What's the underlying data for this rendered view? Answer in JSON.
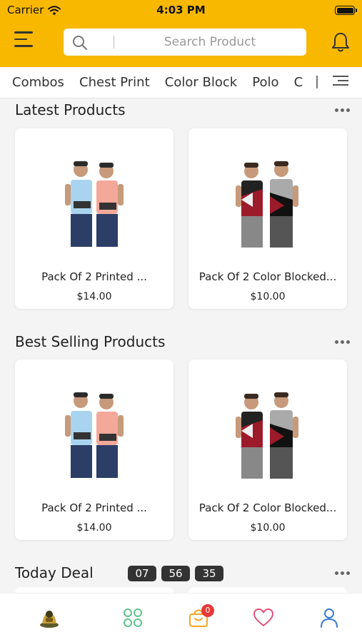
{
  "status_bar": {
    "carrier": "Carrier",
    "time": "4:03 PM"
  },
  "header": {
    "search_placeholder": "Search Product"
  },
  "categories": [
    "Combos",
    "Chest Print",
    "Color Block",
    "Polo",
    "C"
  ],
  "sections": [
    {
      "title": "Latest Products",
      "products": [
        {
          "name": "Pack Of 2 Printed ...",
          "price": "$14.00"
        },
        {
          "name": "Pack Of 2 Color Blocked...",
          "price": "$10.00"
        }
      ]
    },
    {
      "title": "Best Selling Products",
      "products": [
        {
          "name": "Pack Of 2 Printed ...",
          "price": "$14.00"
        },
        {
          "name": "Pack Of 2 Color Blocked...",
          "price": "$10.00"
        }
      ]
    }
  ],
  "today_deal": {
    "title": "Today Deal",
    "timer": [
      "07",
      "56",
      "35"
    ]
  },
  "tab_bar": {
    "cart_badge": "0"
  },
  "colors": {
    "brand": "#f8b800",
    "green": "#5cc38a",
    "orange": "#f5a623",
    "pink": "#e0507a",
    "blue": "#3a7bd5",
    "badge": "#e53935"
  },
  "icons": [
    "menu-icon",
    "search-icon",
    "bell-icon",
    "filter-icon",
    "more-icon",
    "home-logo-icon",
    "categories-icon",
    "cart-icon",
    "heart-icon",
    "user-icon"
  ]
}
